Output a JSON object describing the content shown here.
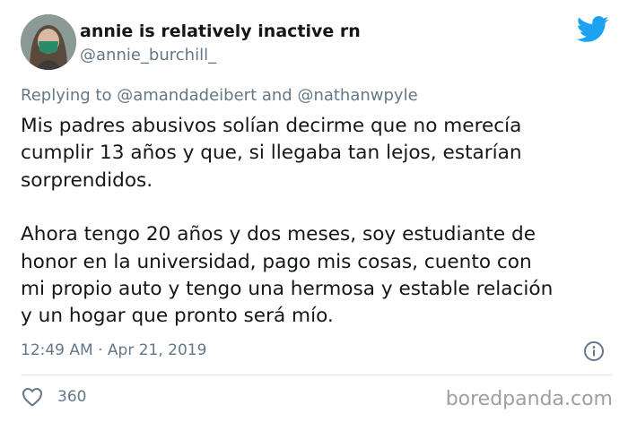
{
  "tweet": {
    "display_name": "annie is relatively inactive rn",
    "handle": "@annie_burchill_",
    "replying_prefix": "Replying to ",
    "reply_to_1": "@amandadeibert",
    "replying_and": " and ",
    "reply_to_2": "@nathanwpyle",
    "paragraph_1": "Mis padres abusivos solían decirme que no merecía\ncumplir 13 años y que, si llegaba tan lejos, estarían\nsorprendidos.",
    "paragraph_2": "Ahora tengo 20 años y dos meses, soy estudiante de\nhonor en la universidad, pago mis cosas, cuento con\nmi propio auto y tengo una hermosa y estable relación\ny un hogar que pronto será mío.",
    "timestamp": "12:49 AM · Apr 21, 2019",
    "like_count": "360"
  },
  "icons": {
    "brand": "twitter-bird-icon",
    "info": "info-icon",
    "like": "heart-icon"
  },
  "watermark": "boredpanda.com",
  "colors": {
    "twitter_blue": "#1da1f2",
    "secondary_text": "#657786",
    "primary_text": "#14171a",
    "mask_green": "#2a8a6a"
  }
}
